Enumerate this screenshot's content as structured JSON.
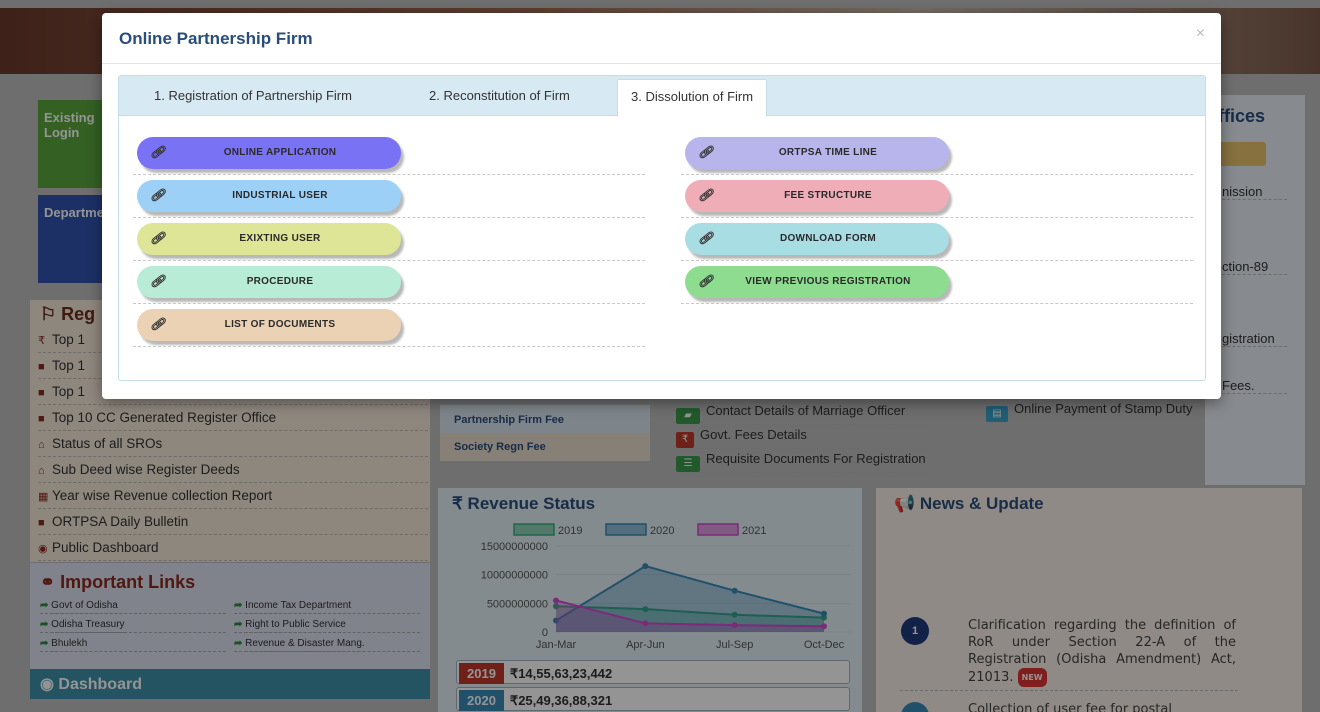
{
  "modal": {
    "title": "Online Partnership Firm",
    "close": "×",
    "tabs": [
      {
        "label": "1. Registration of Partnership Firm"
      },
      {
        "label": "2. Reconstitution of Firm"
      },
      {
        "label": "3. Dissolution of Firm"
      }
    ],
    "active_tab": 2,
    "left_buttons": [
      {
        "label": "ONLINE APPLICATION",
        "color": "#7a72f5"
      },
      {
        "label": "INDUSTRIAL USER",
        "color": "#9dd0f6"
      },
      {
        "label": "EXIXTING USER",
        "color": "#dfe596"
      },
      {
        "label": "PROCEDURE",
        "color": "#b8ecd6"
      },
      {
        "label": "LIST OF DOCUMENTS",
        "color": "#ecd2b4"
      }
    ],
    "right_buttons": [
      {
        "label": "ORTPSA TIME LINE",
        "color": "#b7b5ec"
      },
      {
        "label": "FEE STRUCTURE",
        "color": "#eeadb7"
      },
      {
        "label": "DOWNLOAD FORM",
        "color": "#a8dde3"
      },
      {
        "label": "VIEW PREVIOUS REGISTRATION",
        "color": "#8ddc8f"
      }
    ]
  },
  "background": {
    "existing_login": "Existing Login",
    "department": "Department",
    "reg_title": "Reg",
    "reg_items": [
      "Top 1",
      "Top 1",
      "Top 1",
      "Top 10 CC Generated Register Office",
      "Status of all SROs",
      "Sub Deed wise Register Deeds",
      "Year wise Revenue collection Report",
      "ORTPSA Daily Bulletin",
      "Public Dashboard"
    ],
    "important_links_title": "Important Links",
    "important_links": [
      "Govt of Odisha",
      "Income Tax Department",
      "Odisha Treasury",
      "Right to Public Service",
      "Bhulekh",
      "Revenue & Disaster Mang."
    ],
    "dashboard": "Dashboard",
    "fee_links": [
      "Partnership Firm Fee",
      "Society Regn Fee"
    ],
    "mid_links": [
      "Contact Details of Marriage Officer",
      "Govt. Fees Details",
      "Requisite Documents For Registration"
    ],
    "online_payment": "Online Payment of Stamp Duty",
    "right_title": "ffices",
    "right_texts": [
      "nission",
      "ction-89",
      "gistration",
      "Fees."
    ],
    "revenue_title": "Revenue Status",
    "revenue_rows": [
      {
        "year": "2019",
        "amount": "₹14,55,63,23,442"
      },
      {
        "year": "2020",
        "amount": "₹25,49,36,88,321"
      }
    ],
    "news_title": "News & Update",
    "news_items": [
      {
        "num": "1",
        "text": "Clarification regarding the definition of RoR under Section 22-A of the Registration (Odisha Amendment) Act, 21013.",
        "badge": "NEW"
      },
      {
        "num": "",
        "text": "Collection of user fee for postal"
      }
    ]
  },
  "chart_data": {
    "type": "area",
    "categories": [
      "Jan-Mar",
      "Apr-Jun",
      "Jul-Sep",
      "Oct-Dec"
    ],
    "series": [
      {
        "name": "2019",
        "color": "#35b07a",
        "values": [
          4500000000,
          4000000000,
          3000000000,
          2500000000
        ]
      },
      {
        "name": "2020",
        "color": "#3a8ab8",
        "values": [
          2000000000,
          11500000000,
          7200000000,
          3200000000
        ]
      },
      {
        "name": "2021",
        "color": "#d44ad0",
        "values": [
          5500000000,
          1500000000,
          1200000000,
          1000000000
        ]
      }
    ],
    "y_ticks": [
      "0",
      "5000000000",
      "10000000000",
      "15000000000"
    ],
    "ylim": [
      0,
      15000000000
    ],
    "legend": "top"
  }
}
